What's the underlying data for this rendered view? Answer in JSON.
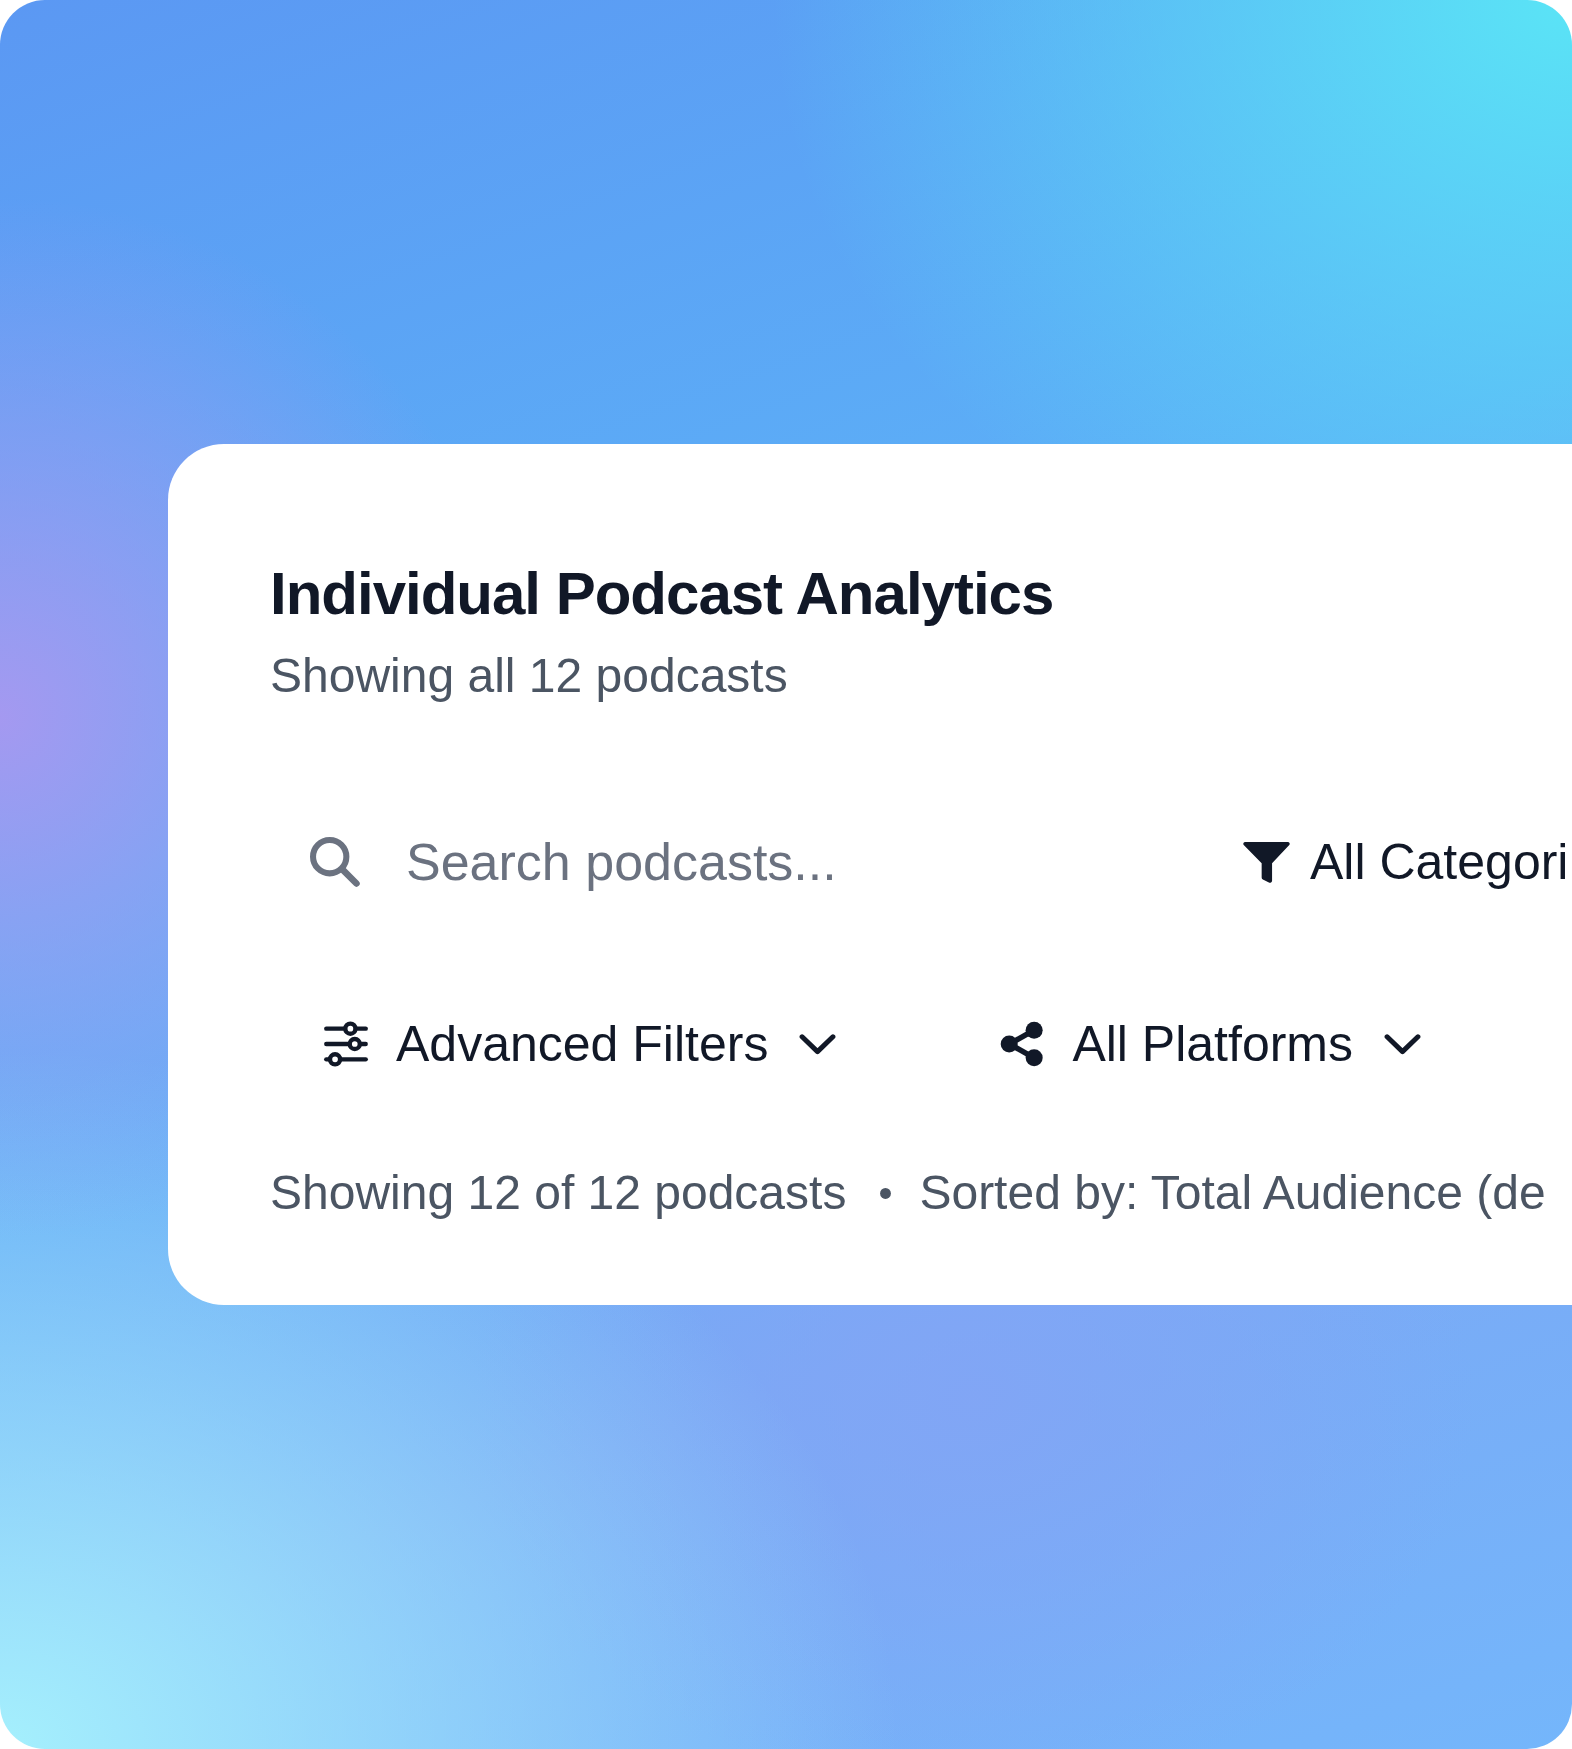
{
  "header": {
    "title": "Individual Podcast Analytics",
    "subtitle": "Showing all 12 podcasts"
  },
  "search": {
    "placeholder": "Search podcasts..."
  },
  "category_filter": {
    "label": "All Categori"
  },
  "dropdowns": [
    {
      "kind": "advanced",
      "label": "Advanced Filters"
    },
    {
      "kind": "platform",
      "label": "All Platforms"
    }
  ],
  "status": {
    "count": "Showing 12 of 12 podcasts",
    "separator": "•",
    "sort": "Sorted by: Total Audience (de"
  }
}
